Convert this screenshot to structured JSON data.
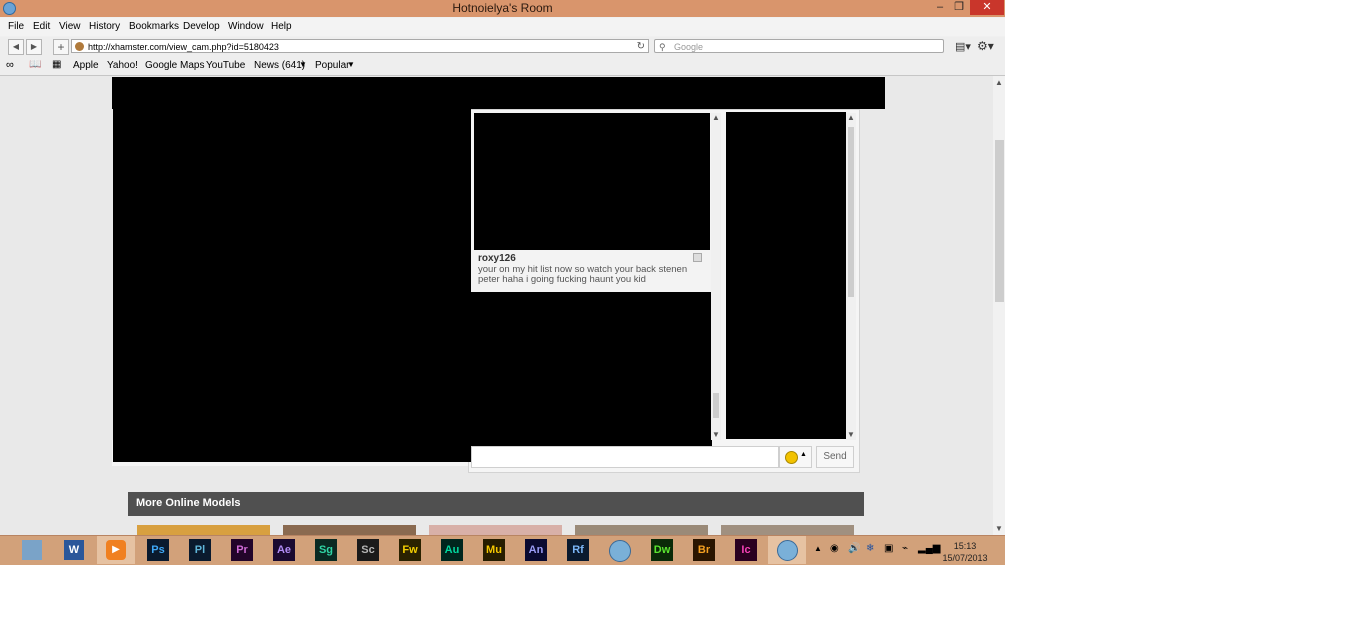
{
  "window": {
    "title": "Hotnoielya's Room",
    "minimize": "–",
    "restore": "❐",
    "close": "✕"
  },
  "menubar": [
    "File",
    "Edit",
    "View",
    "History",
    "Bookmarks",
    "Develop",
    "Window",
    "Help"
  ],
  "nav": {
    "url": "http://xhamster.com/view_cam.php?id=5180423",
    "search_placeholder": "Google"
  },
  "bookmarks": [
    "Apple",
    "Yahoo!",
    "Google Maps",
    "YouTube",
    "News (641)",
    "Popular"
  ],
  "chat": {
    "username": "roxy126",
    "message": "your on my hit list now so watch your back stenen peter haha i going fucking haunt you kid",
    "send_label": "Send"
  },
  "more_models": {
    "title": "More Online Models"
  },
  "taskbar": {
    "apps": [
      "Ps",
      "Pl",
      "Pr",
      "Ae",
      "Sg",
      "Sc",
      "Fw",
      "Au",
      "Mu",
      "An",
      "Rf",
      "Dw",
      "Br",
      "Ic"
    ],
    "time": "15:13",
    "date": "15/07/2013"
  },
  "colors": {
    "titlebar": "#d9956c",
    "taskbar": "#d2a17a",
    "close": "#c9362b"
  }
}
